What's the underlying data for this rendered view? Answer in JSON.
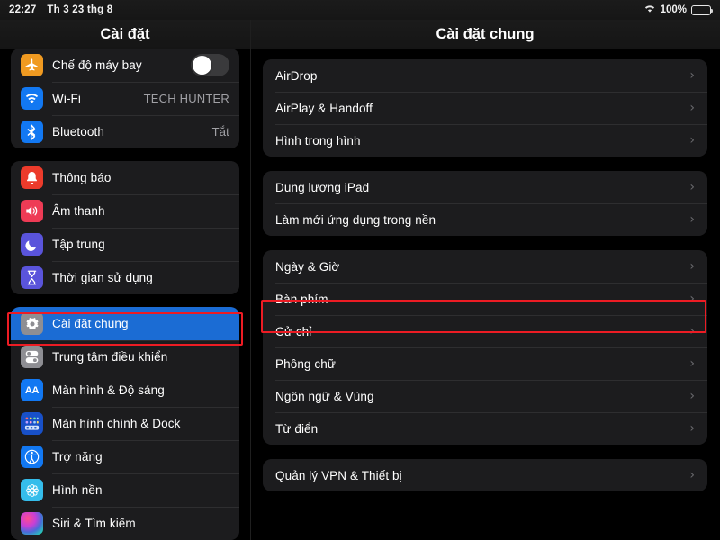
{
  "statusbar": {
    "time": "22:27",
    "date": "Th 3 23 thg 8",
    "wifi_icon": "wifi-icon",
    "battery_percent": "100%",
    "battery_icon": "battery-full-icon"
  },
  "sidebar": {
    "title": "Cài đặt",
    "groups": [
      {
        "items": [
          {
            "label": "Chế độ máy bay",
            "icon": "airplane-icon",
            "icon_color": "#f09a21",
            "control": "toggle",
            "toggle_on": false
          },
          {
            "label": "Wi-Fi",
            "icon": "wifi-icon",
            "icon_color": "#1278f2",
            "value": "TECH HUNTER"
          },
          {
            "label": "Bluetooth",
            "icon": "bluetooth-icon",
            "icon_color": "#1278f2",
            "value": "Tắt"
          }
        ]
      },
      {
        "items": [
          {
            "label": "Thông báo",
            "icon": "bell-icon",
            "icon_color": "#ec3b2b"
          },
          {
            "label": "Âm thanh",
            "icon": "speaker-icon",
            "icon_color": "#ee3b55"
          },
          {
            "label": "Tập trung",
            "icon": "moon-icon",
            "icon_color": "#5a54db"
          },
          {
            "label": "Thời gian sử dụng",
            "icon": "hourglass-icon",
            "icon_color": "#5a54db"
          }
        ]
      },
      {
        "items": [
          {
            "label": "Cài đặt chung",
            "icon": "gear-icon",
            "icon_color": "#8e8e93",
            "selected": true
          },
          {
            "label": "Trung tâm điều khiển",
            "icon": "control-center-icon",
            "icon_color": "#8e8e93"
          },
          {
            "label": "Màn hình & Độ sáng",
            "icon": "aa-icon",
            "icon_color": "#1278f2"
          },
          {
            "label": "Màn hình chính & Dock",
            "icon": "home-screen-icon",
            "icon_color": "#1850c8"
          },
          {
            "label": "Trợ năng",
            "icon": "accessibility-icon",
            "icon_color": "#1278f2"
          },
          {
            "label": "Hình nền",
            "icon": "wallpaper-flower-icon",
            "icon_color": "#35bdeb"
          },
          {
            "label": "Siri & Tìm kiếm",
            "icon": "siri-icon",
            "icon_color": "#9b3fd4"
          }
        ]
      }
    ]
  },
  "detail": {
    "title": "Cài đặt chung",
    "groups": [
      {
        "items": [
          {
            "label": "AirDrop"
          },
          {
            "label": "AirPlay & Handoff"
          },
          {
            "label": "Hình trong hình"
          }
        ]
      },
      {
        "items": [
          {
            "label": "Dung lượng iPad"
          },
          {
            "label": "Làm mới ứng dụng trong nền"
          }
        ]
      },
      {
        "items": [
          {
            "label": "Ngày & Giờ"
          },
          {
            "label": "Bàn phím",
            "highlighted": true
          },
          {
            "label": "Cử chỉ"
          },
          {
            "label": "Phông chữ"
          },
          {
            "label": "Ngôn ngữ & Vùng"
          },
          {
            "label": "Từ điển"
          }
        ]
      },
      {
        "items": [
          {
            "label": "Quản lý VPN & Thiết bị"
          }
        ]
      }
    ],
    "chevron_glyph": "›"
  },
  "annotations": {
    "highlight_color": "#ed1c24",
    "sidebar_target": "Cài đặt chung",
    "detail_target": "Bàn phím"
  }
}
